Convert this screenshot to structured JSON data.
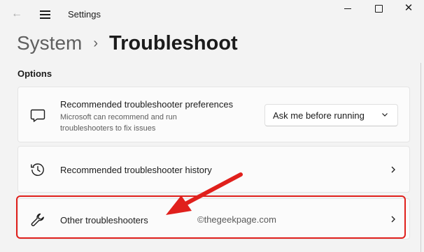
{
  "window": {
    "title": "Settings",
    "back_icon": "back-arrow-icon",
    "menu_icon": "hamburger-menu-icon",
    "controls": [
      "minimize-icon",
      "maximize-icon",
      "close-icon"
    ]
  },
  "breadcrumb": {
    "parent": "System",
    "separator": "›",
    "current": "Troubleshoot"
  },
  "section": {
    "label": "Options"
  },
  "cards": {
    "preferences": {
      "icon": "chat-feedback-icon",
      "title": "Recommended troubleshooter preferences",
      "description": "Microsoft can recommend and run troubleshooters to fix issues",
      "dropdown_value": "Ask me before running"
    },
    "history": {
      "icon": "history-clock-icon",
      "title": "Recommended troubleshooter history"
    },
    "other": {
      "icon": "wrench-icon",
      "title": "Other troubleshooters"
    }
  },
  "annotation": {
    "watermark": "©thegeekpage.com",
    "highlight_color": "#e0201c"
  }
}
